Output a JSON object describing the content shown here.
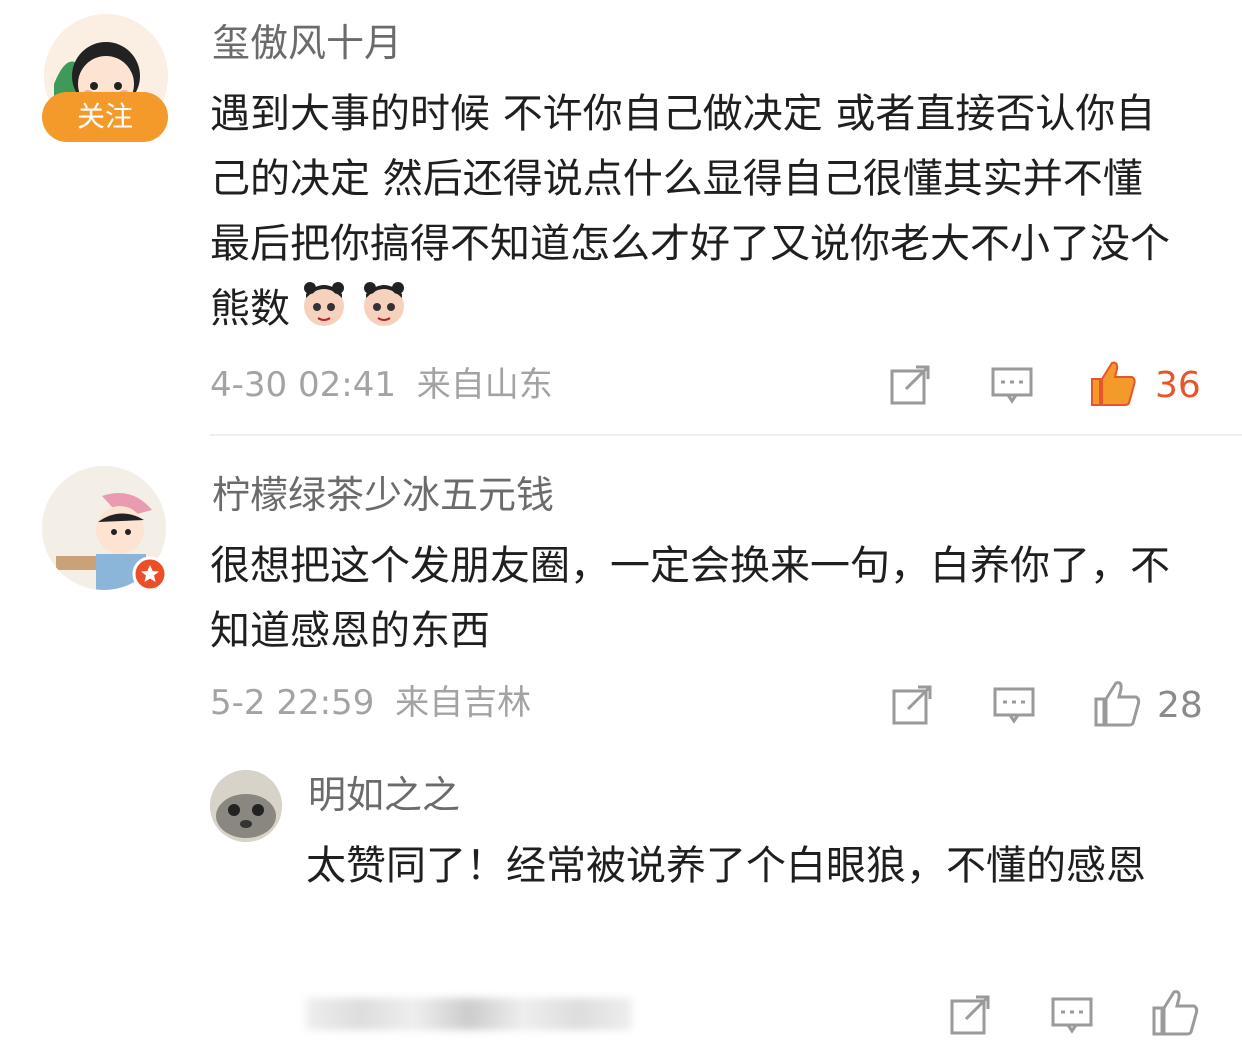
{
  "comments": [
    {
      "username": "玺傲风十月",
      "follow_label": "关注",
      "text": "遇到大事的时候 不许你自己做决定 或者直接否认你自己的决定 然后还得说点什么显得自己很懂其实并不懂 最后把你搞得不知道怎么才好了又说你老大不小了没个熊数",
      "emojis": [
        "nezha-emoji",
        "nezha-emoji"
      ],
      "time": "4-30 02:41",
      "location": "来自山东",
      "likes": "36",
      "liked": true
    },
    {
      "username": "柠檬绿茶少冰五元钱",
      "text": "很想把这个发朋友圈，一定会换来一句，白养你了，不知道感恩的东西",
      "time": "5-2 22:59",
      "location": "来自吉林",
      "likes": "28",
      "liked": false,
      "reply": {
        "username": "明如之之",
        "text": "太赞同了！经常被说养了个白眼狼，不懂的感恩"
      }
    }
  ],
  "colors": {
    "accent_orange": "#f39a2b",
    "liked_red": "#e8542c",
    "icon_gray": "#9a9a9a"
  }
}
